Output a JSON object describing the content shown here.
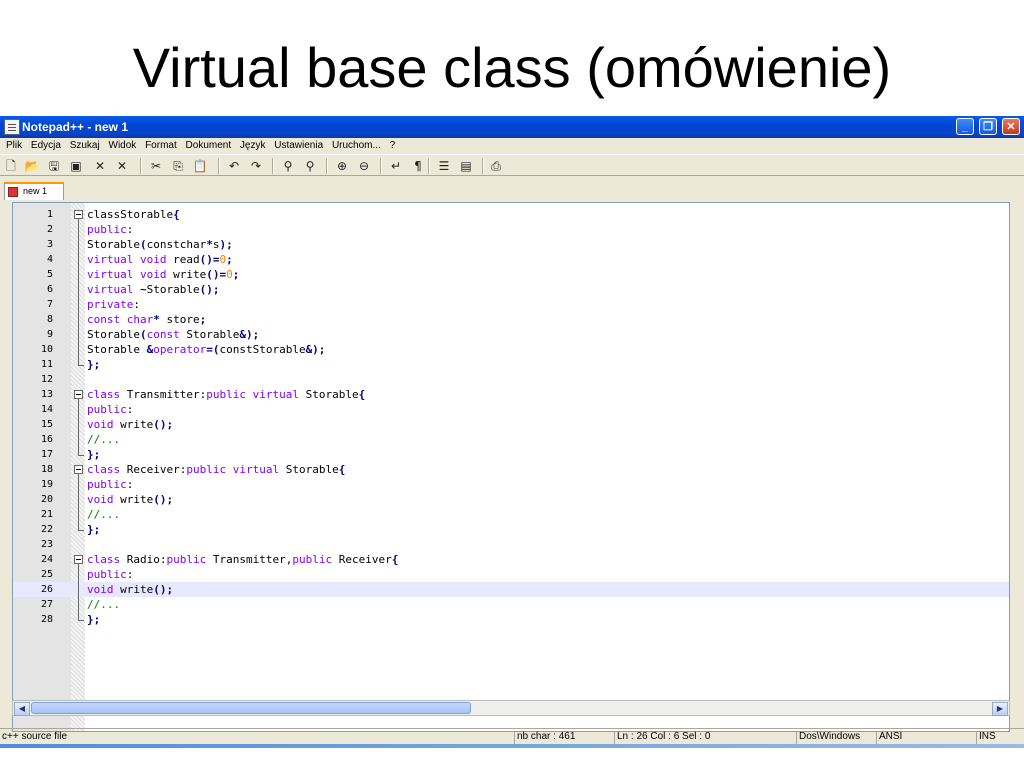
{
  "slide_title": "Virtual base class (omówienie)",
  "window": {
    "title": "Notepad++ - new 1",
    "controls": {
      "minimize": "_",
      "maximize": "❐",
      "close": "✕"
    }
  },
  "menu": [
    "Plik",
    "Edycja",
    "Szukaj",
    "Widok",
    "Format",
    "Dokument",
    "Język",
    "Ustawienia",
    "Uruchom...",
    "?"
  ],
  "toolbar_icons": [
    "new-file-icon",
    "open-folder-icon",
    "save-icon",
    "save-all-icon",
    "close-icon",
    "close-all-icon",
    "cut-icon",
    "copy-icon",
    "paste-icon",
    "undo-icon",
    "redo-icon",
    "find-icon",
    "replace-icon",
    "zoom-in-icon",
    "zoom-out-icon",
    "wrap-icon",
    "show-all-chars-icon",
    "indent-guide-icon",
    "user-lang-icon",
    "print-icon"
  ],
  "tab": {
    "label": "new 1"
  },
  "current_line": 26,
  "code_lines": [
    {
      "n": "1",
      "text": "classStorable{"
    },
    {
      "n": "2",
      "text": "public:"
    },
    {
      "n": "3",
      "text": "Storable(constchar*s);"
    },
    {
      "n": "4",
      "text": "virtual void read()=0;"
    },
    {
      "n": "5",
      "text": "virtual void write()=0;"
    },
    {
      "n": "6",
      "text": "virtual ~Storable();"
    },
    {
      "n": "7",
      "text": "private:"
    },
    {
      "n": "8",
      "text": "const char* store;"
    },
    {
      "n": "9",
      "text": "Storable(const Storable&);"
    },
    {
      "n": "10",
      "text": "Storable &operator=(constStorable&);"
    },
    {
      "n": "11",
      "text": "};"
    },
    {
      "n": "12",
      "text": ""
    },
    {
      "n": "13",
      "text": "class Transmitter:public virtual Storable{"
    },
    {
      "n": "14",
      "text": "public:"
    },
    {
      "n": "15",
      "text": "void write();"
    },
    {
      "n": "16",
      "text": "//..."
    },
    {
      "n": "17",
      "text": "};"
    },
    {
      "n": "18",
      "text": "class Receiver:public virtual Storable{"
    },
    {
      "n": "19",
      "text": "public:"
    },
    {
      "n": "20",
      "text": "void write();"
    },
    {
      "n": "21",
      "text": "//..."
    },
    {
      "n": "22",
      "text": "};"
    },
    {
      "n": "23",
      "text": ""
    },
    {
      "n": "24",
      "text": "class Radio:public Transmitter,public Receiver{"
    },
    {
      "n": "25",
      "text": "public:"
    },
    {
      "n": "26",
      "text": "void write();"
    },
    {
      "n": "27",
      "text": "//..."
    },
    {
      "n": "28",
      "text": "};"
    }
  ],
  "status": {
    "type": "c++ source file",
    "nb_char": "nb char : 461",
    "position": "Ln : 26    Col : 6    Sel : 0",
    "eol": "Dos\\Windows",
    "encoding": "ANSI",
    "mode": "INS"
  },
  "colors": {
    "keyword": "#8000ff",
    "number": "#ff8000",
    "comment": "#008000",
    "current_line": "#e8e8ff",
    "titlebar": "#0a5be5"
  }
}
